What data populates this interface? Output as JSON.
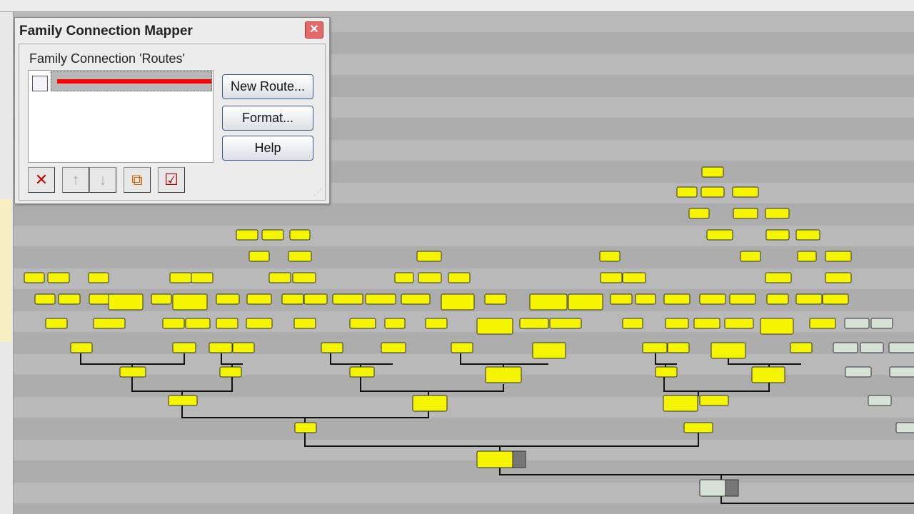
{
  "dialog": {
    "title": "Family Connection Mapper",
    "close_icon": "close-icon",
    "routes_label": "Family Connection 'Routes'",
    "routes": [
      {
        "checked": false,
        "color": "#ff0000"
      }
    ],
    "buttons": {
      "new_route": "New Route...",
      "format": "Format...",
      "help": "Help"
    },
    "tools": [
      {
        "icon": "delete-icon",
        "glyph": "✕",
        "enabled": true
      },
      {
        "icon": "move-up-icon",
        "glyph": "↑",
        "enabled": false
      },
      {
        "icon": "move-down-icon",
        "glyph": "↓",
        "enabled": false
      },
      {
        "icon": "route-chart-icon",
        "glyph": "⧉",
        "enabled": true
      },
      {
        "icon": "checklist-icon",
        "glyph": "☑",
        "enabled": true
      }
    ]
  },
  "colors": {
    "ancestor_box": "#f5f500",
    "descendant_box": "#d6e2d6",
    "route": "#ff0000"
  }
}
